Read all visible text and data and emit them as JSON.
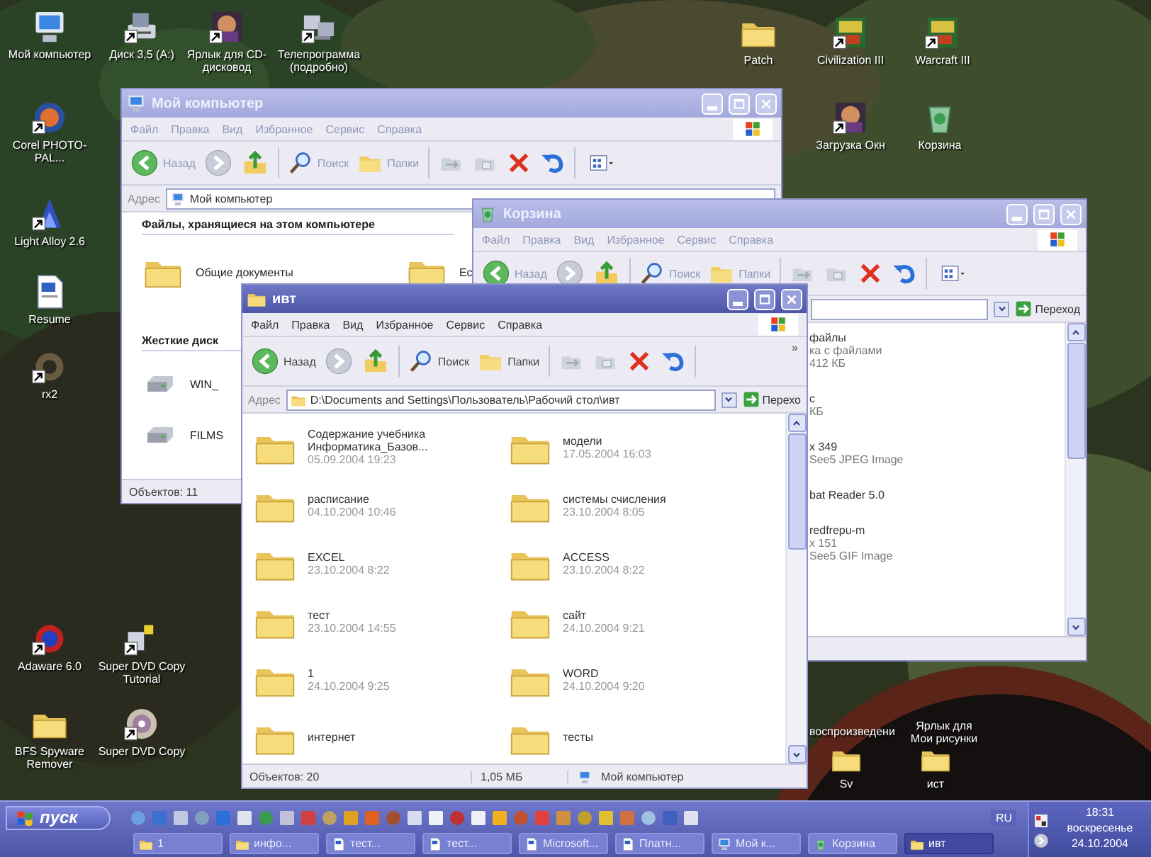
{
  "desktop": {
    "icons": [
      {
        "label": "Мой компьютер",
        "shortcut": false
      },
      {
        "label": "Диск 3,5 (A:)",
        "shortcut": true
      },
      {
        "label": "Ярлык для CD-дисковод",
        "shortcut": true
      },
      {
        "label": "Телепрограмма (подробно)",
        "shortcut": true
      },
      {
        "label": "Patch",
        "shortcut": false
      },
      {
        "label": "Civilization III",
        "shortcut": true
      },
      {
        "label": "Warcraft III",
        "shortcut": true
      },
      {
        "label": "Corel PHOTO-PAL...",
        "shortcut": true
      },
      {
        "label": "Загрузка Окн",
        "shortcut": true
      },
      {
        "label": "Корзина",
        "shortcut": false
      },
      {
        "label": "Light Alloy 2.6",
        "shortcut": true
      },
      {
        "label": "Resume",
        "shortcut": false
      },
      {
        "label": "rx2",
        "shortcut": true
      },
      {
        "label": "Adaware 6.0",
        "shortcut": true
      },
      {
        "label": "Super DVD Copy Tutorial",
        "shortcut": true
      },
      {
        "label": "BFS Spyware Remover",
        "shortcut": false
      },
      {
        "label": "Super DVD Copy",
        "shortcut": true
      },
      {
        "label": "Sv",
        "shortcut": false
      },
      {
        "label": "ист",
        "shortcut": false
      }
    ],
    "label_fragments": [
      "воспроизведени",
      "Ярлык для Мои рисунки"
    ]
  },
  "my_computer_window": {
    "title": "Мой компьютер",
    "active": false,
    "menu": [
      "Файл",
      "Правка",
      "Вид",
      "Избранное",
      "Сервис",
      "Справка"
    ],
    "toolbar": {
      "back": "Назад",
      "search": "Поиск",
      "folders": "Папки"
    },
    "address_label": "Адрес",
    "address": "Мой компьютер",
    "sections": [
      {
        "heading": "Файлы, хранящиеся на этом компьютере",
        "kind": "folders",
        "items": [
          "Общие документы",
          "Ес"
        ]
      },
      {
        "heading": "Жесткие диск",
        "kind": "drives",
        "items": [
          "WIN_",
          "FILMS"
        ]
      }
    ],
    "status": "Объектов: 11"
  },
  "recycle_bin_window": {
    "title": "Корзина",
    "active": false,
    "menu": [
      "Файл",
      "Правка",
      "Вид",
      "Избранное",
      "Сервис",
      "Справка"
    ],
    "toolbar": {
      "back": "Назад",
      "search": "Поиск",
      "folders": "Папки"
    },
    "go": "Переход",
    "items": [
      {
        "lines": [
          "файлы",
          "ка с файлами",
          "412 КБ"
        ]
      },
      {
        "lines": [
          "с",
          "КБ"
        ]
      },
      {
        "lines": [
          "x 349",
          "See5 JPEG Image"
        ]
      },
      {
        "lines": [
          "bat Reader 5.0"
        ]
      },
      {
        "lines": [
          "redfrepu-m",
          "x 151",
          "See5 GIF Image"
        ]
      }
    ]
  },
  "folder_window": {
    "title": "ивт",
    "active": true,
    "menu": [
      "Файл",
      "Правка",
      "Вид",
      "Избранное",
      "Сервис",
      "Справка"
    ],
    "toolbar": {
      "back": "Назад",
      "search": "Поиск",
      "folders": "Папки",
      "more": "»"
    },
    "address_label": "Адрес",
    "address": "D:\\Documents and Settings\\Пользователь\\Рабочий стол\\ивт",
    "go": "Перехо",
    "items": [
      {
        "name": "Содержание учебника Информатика_Базов...",
        "date": "05.09.2004 19:23"
      },
      {
        "name": "модели",
        "date": "17.05.2004 16:03"
      },
      {
        "name": "расписание",
        "date": "04.10.2004 10:46"
      },
      {
        "name": "системы счисления",
        "date": "23.10.2004 8:05"
      },
      {
        "name": "EXCEL",
        "date": "23.10.2004 8:22"
      },
      {
        "name": "ACCESS",
        "date": "23.10.2004 8:22"
      },
      {
        "name": "тест",
        "date": "23.10.2004 14:55"
      },
      {
        "name": "сайт",
        "date": "24.10.2004 9:21"
      },
      {
        "name": "1",
        "date": "24.10.2004 9:25"
      },
      {
        "name": "WORD",
        "date": "24.10.2004 9:20"
      },
      {
        "name": "интернет"
      },
      {
        "name": "тесты"
      }
    ],
    "status": [
      "Объектов: 20",
      "1,05 МБ",
      "Мой компьютер"
    ]
  },
  "taskbar": {
    "start": "пуск",
    "language": "RU",
    "tasks": [
      {
        "label": "1",
        "selected": false
      },
      {
        "label": "инфо...",
        "selected": false
      },
      {
        "label": "тест...",
        "selected": false
      },
      {
        "label": "тест...",
        "selected": false
      },
      {
        "label": "Microsoft...",
        "selected": false
      },
      {
        "label": "Платн...",
        "selected": false
      },
      {
        "label": "Мой к...",
        "selected": false
      },
      {
        "label": "Корзина",
        "selected": false
      },
      {
        "label": "ивт",
        "selected": true
      }
    ],
    "clock": {
      "time": "18:31",
      "day": "воскресенье",
      "date": "24.10.2004"
    }
  }
}
